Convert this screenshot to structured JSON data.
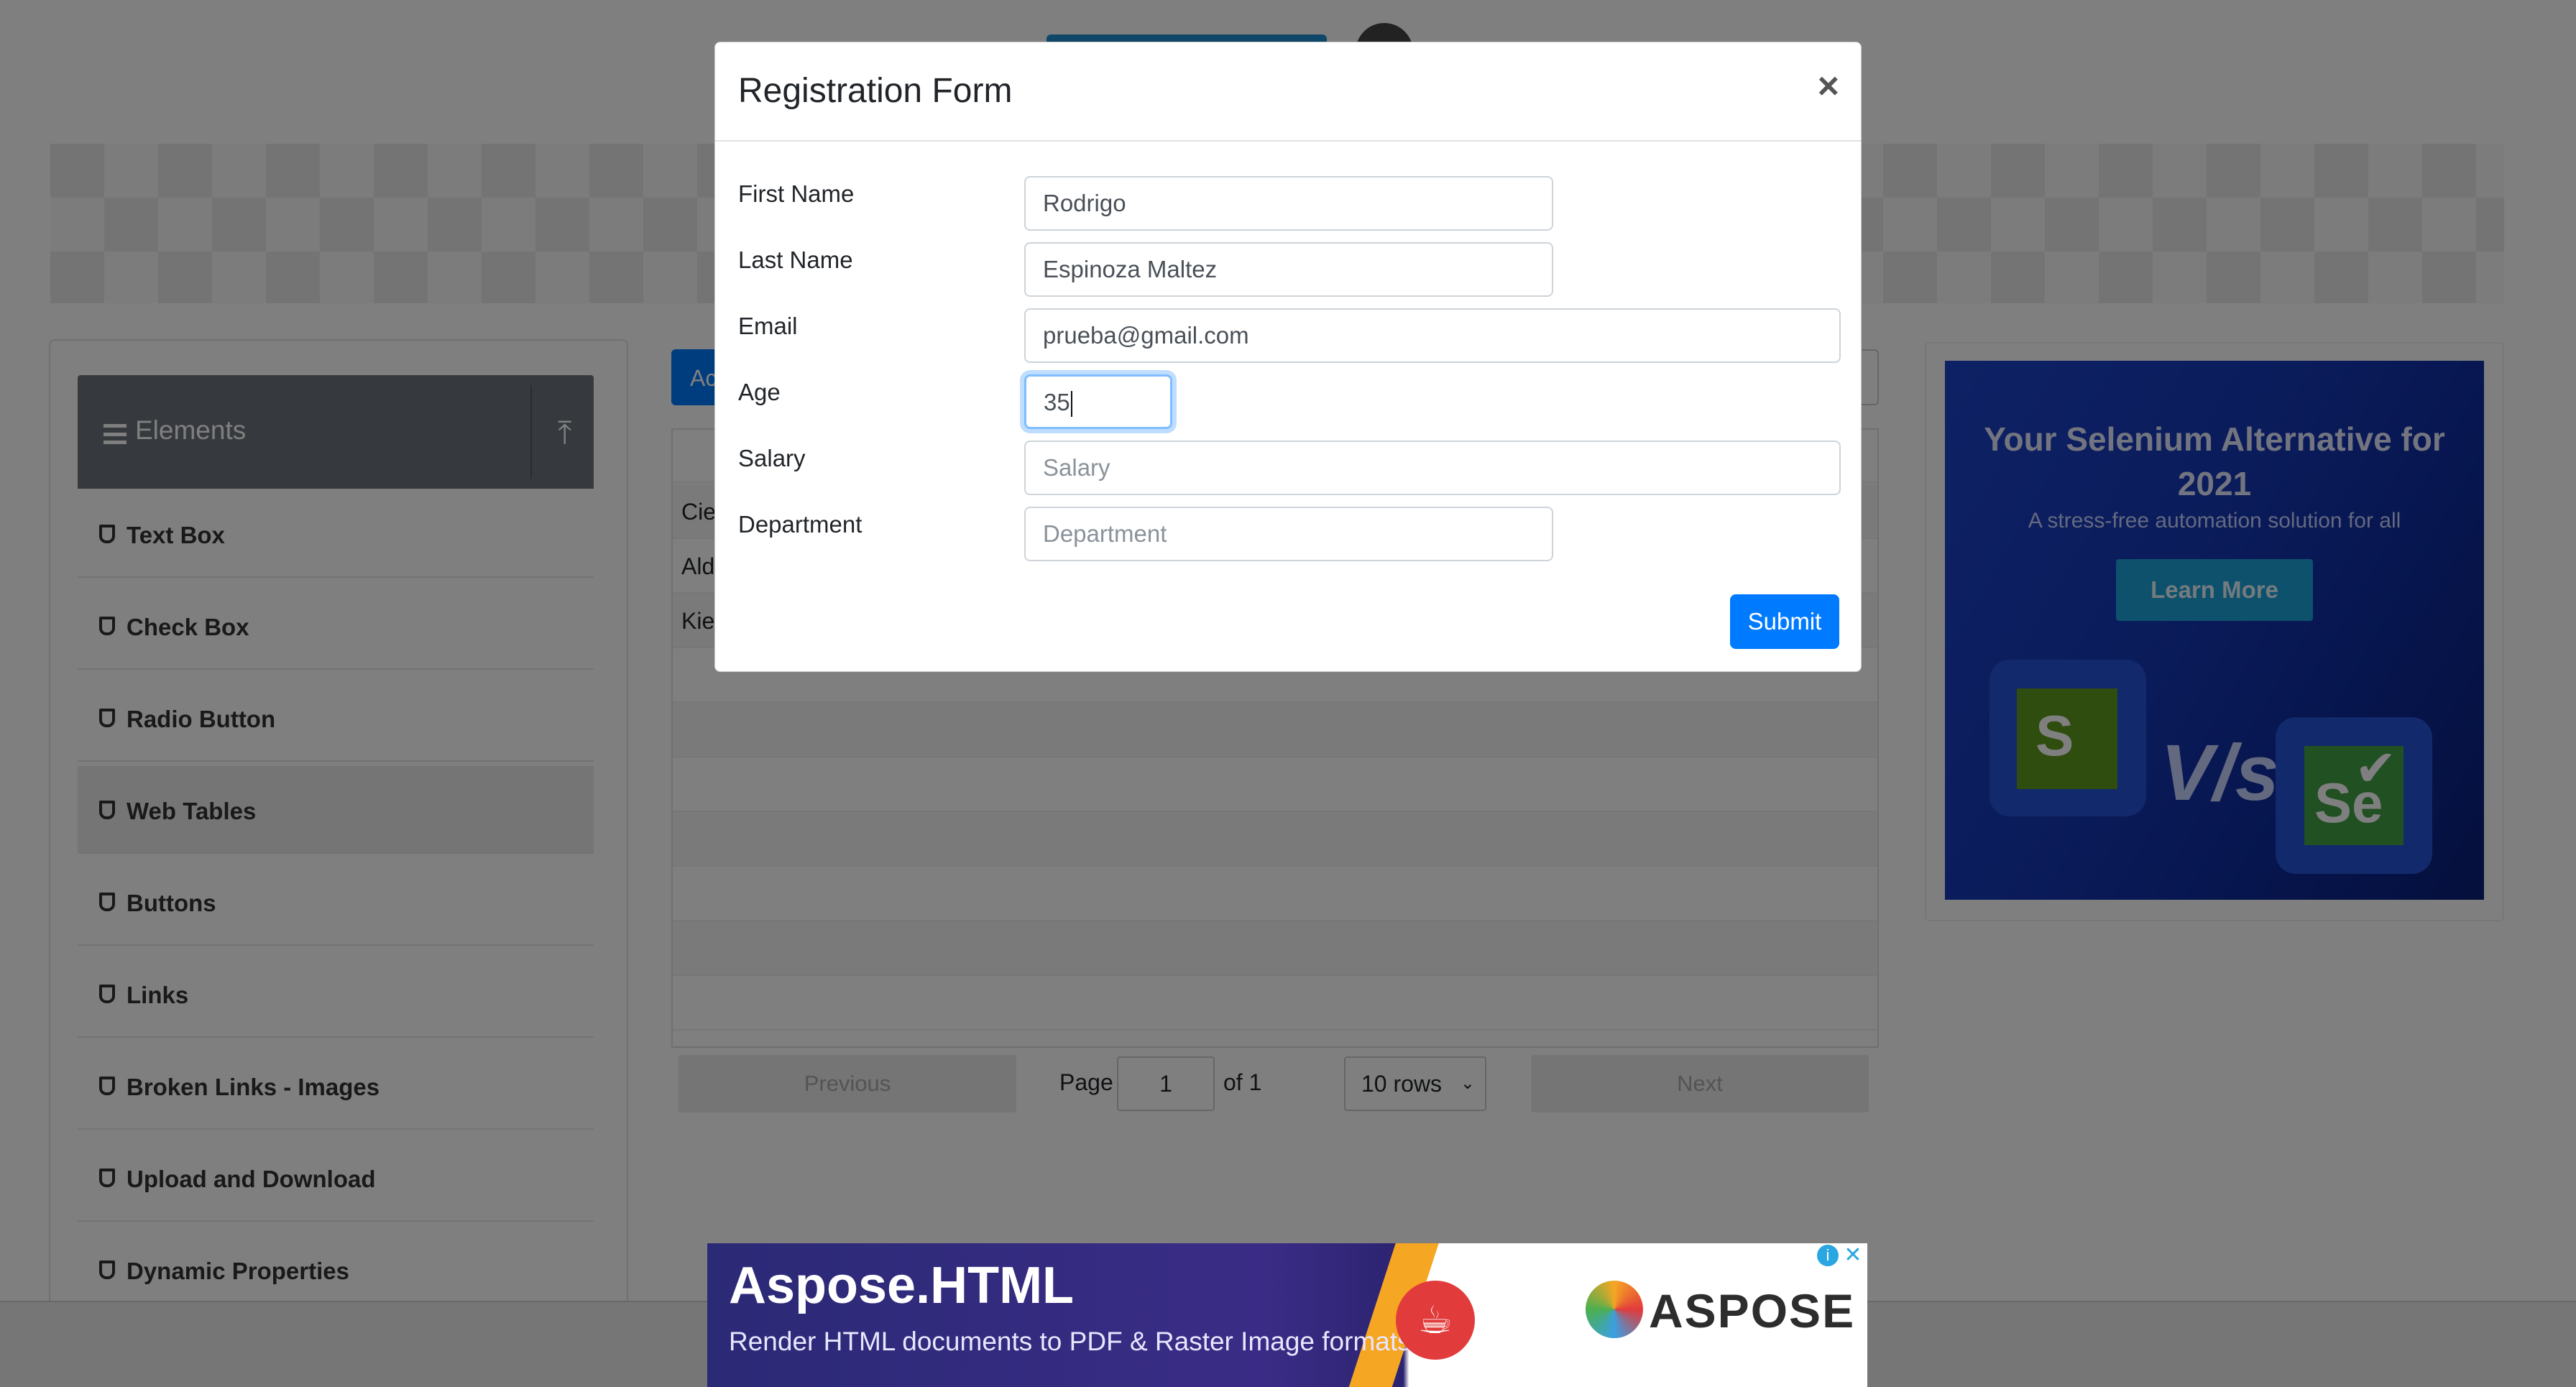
{
  "sidebar": {
    "group_title": "Elements",
    "items": [
      {
        "label": "Text Box"
      },
      {
        "label": "Check Box"
      },
      {
        "label": "Radio Button"
      },
      {
        "label": "Web Tables"
      },
      {
        "label": "Buttons"
      },
      {
        "label": "Links"
      },
      {
        "label": "Broken Links - Images"
      },
      {
        "label": "Upload and Download"
      },
      {
        "label": "Dynamic Properties"
      }
    ],
    "active_item": "Web Tables"
  },
  "table": {
    "add_button_label": "Ac",
    "rows": [
      "Cie",
      "Ald",
      "Kie"
    ]
  },
  "pagination": {
    "previous_label": "Previous",
    "page_label": "Page",
    "page_value": "1",
    "of_label": "of 1",
    "rows_option": "10 rows",
    "next_label": "Next"
  },
  "ad_right": {
    "title": "Your Selenium Alternative for 2021",
    "subtitle": "A stress-free automation solution for all",
    "button_label": "Learn More",
    "tile_left_letter": "S",
    "vs_text": "V/s",
    "tile_right_letters": "Se"
  },
  "modal": {
    "title": "Registration Form",
    "close_symbol": "×",
    "fields": {
      "first_name": {
        "label": "First Name",
        "value": "Rodrigo",
        "placeholder": ""
      },
      "last_name": {
        "label": "Last Name",
        "value": "Espinoza Maltez",
        "placeholder": ""
      },
      "email": {
        "label": "Email",
        "value": "prueba@gmail.com",
        "placeholder": ""
      },
      "age": {
        "label": "Age",
        "value": "35",
        "placeholder": ""
      },
      "salary": {
        "label": "Salary",
        "value": "",
        "placeholder": "Salary"
      },
      "department": {
        "label": "Department",
        "value": "",
        "placeholder": "Department"
      }
    },
    "submit_label": "Submit"
  },
  "ad_bottom": {
    "headline": "Aspose.HTML",
    "tagline": "Render HTML documents to PDF & Raster Image formats",
    "brand": "ASPOSE"
  },
  "colors": {
    "primary": "#007bff",
    "sidebar_header": "#6c757d",
    "overlay": "rgba(0,0,0,0.5)"
  },
  "icons": [
    "hamburger-icon",
    "upload-icon",
    "shield-icon",
    "close-icon",
    "chevron-down-icon",
    "java-icon",
    "aspose-logo-icon",
    "adchoices-icon"
  ]
}
